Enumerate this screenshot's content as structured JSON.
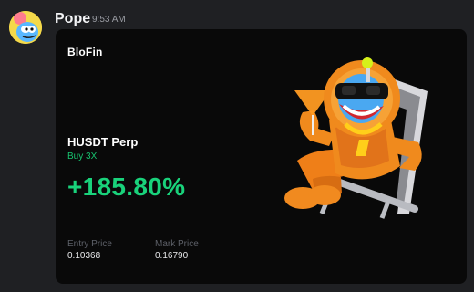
{
  "message": {
    "author": "Pope",
    "time": "9:53 AM"
  },
  "card": {
    "brand": "BloFin",
    "pair": "HUSDT Perp",
    "side": "Buy 3X",
    "pnl": "+185.80%",
    "entry_label": "Entry Price",
    "entry_value": "0.10368",
    "mark_label": "Mark Price",
    "mark_value": "0.16790"
  },
  "icons": {
    "avatar": "avatar-icon",
    "mascot": "mascot-illustration"
  },
  "colors": {
    "background": "#1f2023",
    "card": "#090909",
    "green": "#19d27b",
    "muted": "#5d6068"
  }
}
